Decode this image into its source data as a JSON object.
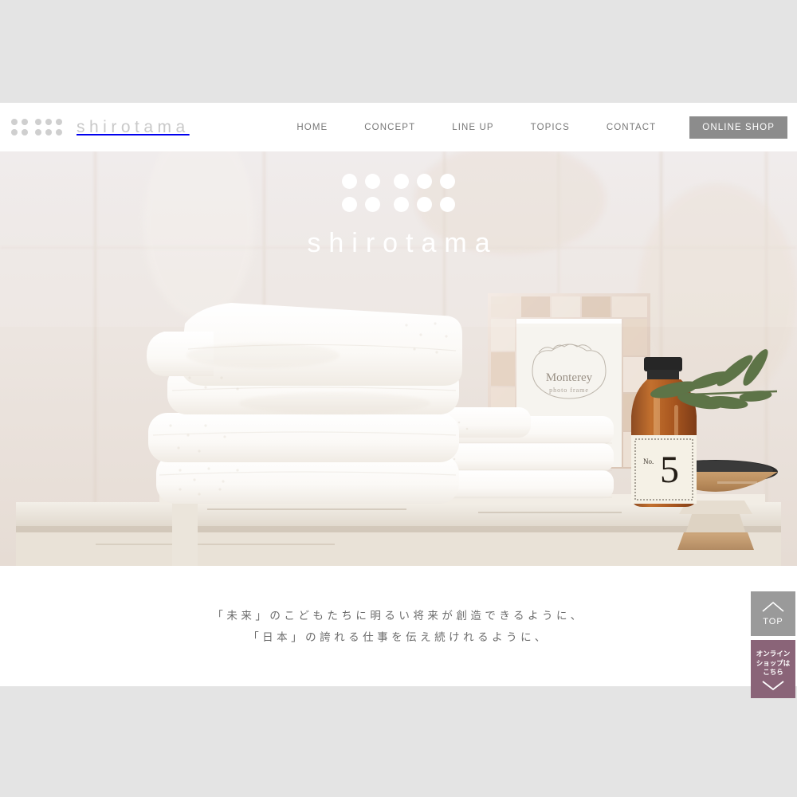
{
  "page": {
    "background_color": "#e4e4e4",
    "content_background": "#ffffff"
  },
  "header": {
    "brand_name": "shirotama",
    "logo_icon": "six-dots-logo-icon",
    "nav_items": [
      {
        "label": "HOME",
        "name": "nav-home"
      },
      {
        "label": "CONCEPT",
        "name": "nav-concept"
      },
      {
        "label": "LINE UP",
        "name": "nav-line-up"
      },
      {
        "label": "TOPICS",
        "name": "nav-topics"
      },
      {
        "label": "CONTACT",
        "name": "nav-contact"
      }
    ],
    "shop_button_label": "ONLINE SHOP",
    "shop_button_color": "#8c8c8c"
  },
  "hero": {
    "logo_icon": "six-dots-logo-icon",
    "brand_name": "shirotama",
    "photo_description": "Stack of white folded towels on a distressed white wooden bench with a Monterey mother-of-pearl photo frame, wooden pedestal bowls, an amber No.5 apothecary bottle and an olive branch against whitewashed shiplap wall",
    "frame_title": "Monterey",
    "frame_subtitle": "photo frame",
    "bottle_label": "No. 5"
  },
  "tagline": {
    "line1": "「未来」のこどもたちに明るい将来が創造できるように、",
    "line2": "「日本」の誇れる仕事を伝え続けれるように、"
  },
  "side_rail": {
    "top_button": {
      "label": "TOP",
      "icon": "chevron-up-icon",
      "color": "#9a9a9a"
    },
    "shop_button": {
      "line1": "オンライン",
      "line2": "ショップは",
      "line3": "こちら",
      "icon": "chevron-down-icon",
      "color": "#8a6478"
    }
  }
}
